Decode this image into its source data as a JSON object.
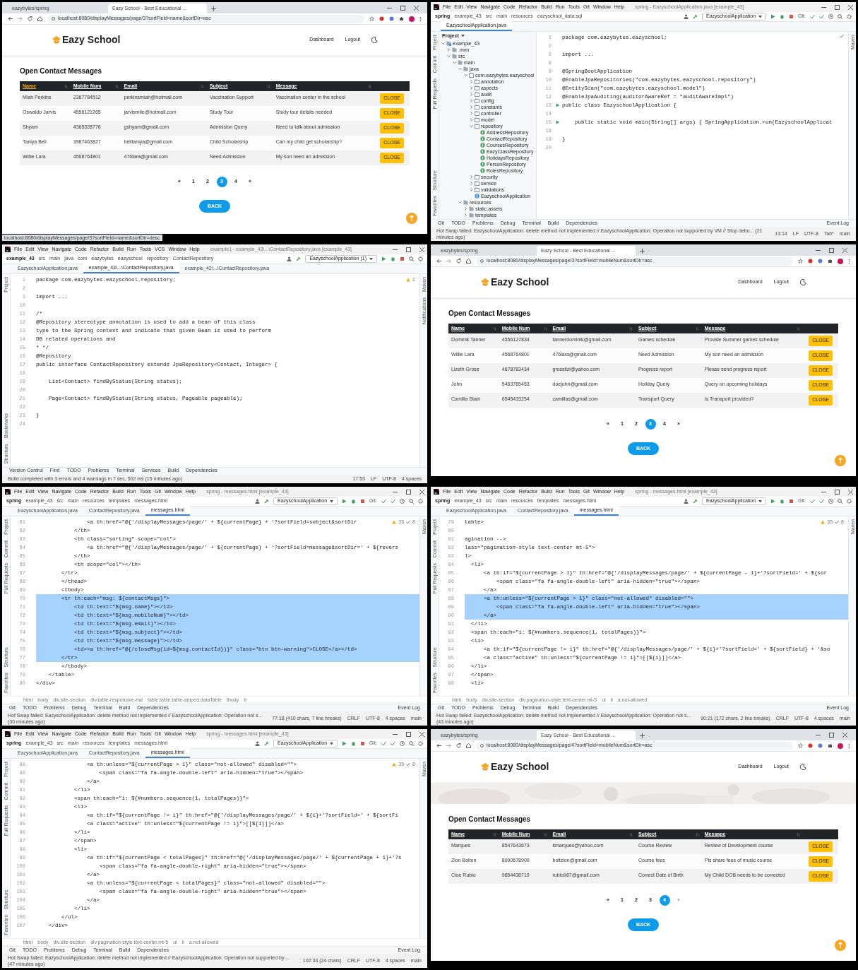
{
  "panels": [
    {
      "kind": "browser",
      "tabs": [
        {
          "title": "eazybytes/spring",
          "selected": false
        },
        {
          "title": "Eazy School - Best Educational ...",
          "selected": true
        }
      ],
      "url": "localhost:8080/displayMessages/page/3?sortField=name&sortDir=asc",
      "logo": "Eazy School",
      "nav": [
        "Dashboard",
        "Logout"
      ],
      "heading": "Open Contact Messages",
      "columns": [
        {
          "label": "Name",
          "active": true
        },
        {
          "label": "Mobile Num",
          "active": false
        },
        {
          "label": "Email",
          "active": false
        },
        {
          "label": "Subject",
          "active": false
        },
        {
          "label": "Message",
          "active": false
        }
      ],
      "rows": [
        {
          "cells": [
            "Miah Perkins",
            "2367784512",
            "perkinsmiah@hotmail.com",
            "Vaccination Support",
            "Vaccination center in the school"
          ],
          "action": "CLOSE"
        },
        {
          "cells": [
            "Oswaldo Jarvis",
            "4556121265",
            "jarvismile@hotmail.com",
            "Study Tour",
            "Study tour details needed"
          ],
          "action": "CLOSE"
        },
        {
          "cells": [
            "Shyam",
            "4365328776",
            "gshyam@gmail.com",
            "Admission Query",
            "Need to talk about admission"
          ],
          "action": "CLOSE"
        },
        {
          "cells": [
            "Taniya Bell",
            "3987463827",
            "belltaniya@gmail.com",
            "Child Scholarship",
            "Can my child get scholarship?"
          ],
          "action": "CLOSE"
        },
        {
          "cells": [
            "Willie Lara",
            "4568764801",
            "476lara@gmail.com",
            "Need Admission",
            "My son need an admission"
          ],
          "action": "CLOSE"
        }
      ],
      "pages": [
        {
          "label": "«",
          "selected": false,
          "disabled": false
        },
        {
          "label": "1",
          "selected": false,
          "disabled": false
        },
        {
          "label": "2",
          "selected": false,
          "disabled": false
        },
        {
          "label": "3",
          "selected": true,
          "disabled": false
        },
        {
          "label": "4",
          "selected": false,
          "disabled": false
        },
        {
          "label": "»",
          "selected": false,
          "disabled": false
        }
      ],
      "back": "BACK",
      "status_link": "localhost:8080/displayMessages/page/3?sortField=name&sortDir=desc"
    },
    {
      "kind": "ide",
      "menu": [
        "File",
        "Edit",
        "View",
        "Navigate",
        "Code",
        "Refactor",
        "Build",
        "Run",
        "Tools",
        "Git",
        "Window",
        "Help"
      ],
      "title": "spring - EazyschoolApplication.java [example_43]",
      "crumbs": [
        "spring",
        "example_43",
        "src",
        "main",
        "resources",
        "eazyschool_data.sql"
      ],
      "run_config": "EazyschoolApplication",
      "git_label": "Git:",
      "tabs": [
        {
          "label": "EazyschoolApplication.java",
          "selected": true
        }
      ],
      "side_top": [
        "Project",
        "Commit",
        "Pull Requests"
      ],
      "side_bottom": [
        "Structure",
        "Favorites"
      ],
      "side_right": [
        "Maven"
      ],
      "tree": {
        "title": "Project",
        "items": [
          {
            "label": "example_43",
            "kind": "module",
            "expanded": true,
            "children": [
              {
                "label": ".mvn",
                "kind": "folder",
                "expanded": false
              },
              {
                "label": "src",
                "kind": "folder",
                "expanded": true,
                "children": [
                  {
                    "label": "main",
                    "kind": "folder",
                    "expanded": true,
                    "children": [
                      {
                        "label": "java",
                        "kind": "folder",
                        "expanded": true,
                        "children": [
                          {
                            "label": "com.eazybytes.eazyschool",
                            "kind": "package",
                            "expanded": true,
                            "children": [
                              {
                                "label": "annotation",
                                "kind": "package",
                                "expanded": false
                              },
                              {
                                "label": "aspects",
                                "kind": "package",
                                "expanded": false
                              },
                              {
                                "label": "audit",
                                "kind": "package",
                                "expanded": false
                              },
                              {
                                "label": "config",
                                "kind": "package",
                                "expanded": false
                              },
                              {
                                "label": "constants",
                                "kind": "package",
                                "expanded": false
                              },
                              {
                                "label": "controller",
                                "kind": "package",
                                "expanded": false
                              },
                              {
                                "label": "model",
                                "kind": "package",
                                "expanded": false
                              },
                              {
                                "label": "repository",
                                "kind": "package",
                                "expanded": true,
                                "children": [
                                  {
                                    "label": "AddressRepository",
                                    "kind": "interface"
                                  },
                                  {
                                    "label": "ContactRepository",
                                    "kind": "interface"
                                  },
                                  {
                                    "label": "CoursesRepository",
                                    "kind": "interface"
                                  },
                                  {
                                    "label": "EazyClassRepository",
                                    "kind": "interface"
                                  },
                                  {
                                    "label": "HolidaysRepository",
                                    "kind": "interface"
                                  },
                                  {
                                    "label": "PersonRepository",
                                    "kind": "interface"
                                  },
                                  {
                                    "label": "RolesRepository",
                                    "kind": "interface"
                                  }
                                ]
                              },
                              {
                                "label": "security",
                                "kind": "package",
                                "expanded": false
                              },
                              {
                                "label": "service",
                                "kind": "package",
                                "expanded": false
                              },
                              {
                                "label": "validations",
                                "kind": "package",
                                "expanded": false
                              },
                              {
                                "label": "EazyschoolApplication",
                                "kind": "class"
                              }
                            ]
                          }
                        ]
                      },
                      {
                        "label": "resources",
                        "kind": "folder",
                        "expanded": true,
                        "children": [
                          {
                            "label": "static.assets",
                            "kind": "folder",
                            "expanded": false
                          },
                          {
                            "label": "templates",
                            "kind": "folder",
                            "expanded": false
                          }
                        ]
                      }
                    ]
                  }
                ]
              }
            ]
          }
        ]
      },
      "inspections": [
        {
          "kind": "ok"
        }
      ],
      "lines": [
        {
          "n": "1",
          "code": "package com.eazybytes.eazyschool;",
          "run": false
        },
        {
          "n": "2",
          "run": false
        },
        {
          "n": "3",
          "code": "import ...",
          "run": false
        },
        {
          "n": "8",
          "run": false
        },
        {
          "n": "9",
          "code": "@SpringBootApplication",
          "run": false
        },
        {
          "n": "10",
          "code": "@EnableJpaRepositories(\"com.eazybytes.eazyschool.repository\")",
          "run": false
        },
        {
          "n": "11",
          "code": "@EntityScan(\"com.eazybytes.eazyschool.model\")",
          "run": false
        },
        {
          "n": "12",
          "code": "@EnableJpaAuditing(auditorAwareRef = \"auditAwareImpl\")",
          "run": false
        },
        {
          "n": "13",
          "code": "public class EazyschoolApplication {",
          "run": true
        },
        {
          "n": "14",
          "run": false
        },
        {
          "n": "15",
          "code": "    public static void main(String[] args) { SpringApplication.run(EazyschoolApplicat",
          "run": true
        },
        {
          "n": "18",
          "run": false
        },
        {
          "n": "19",
          "code": "}",
          "run": false
        },
        {
          "n": "20",
          "run": false
        }
      ],
      "tool_windows": [
        "Git",
        "TODO",
        "Problems",
        "Debug",
        "Terminal",
        "Build",
        "Dependencies"
      ],
      "event_log": "Event Log",
      "status": "Hot Swap failed: EazyschoolApplication: delete method not implemented // EazyschoolApplication: Operation not supported by VM // Stop debu... (21 minutes ago)",
      "status_right": [
        "13:14",
        "LF",
        "UTF-8",
        "Tab*",
        "main"
      ]
    },
    {
      "kind": "ide",
      "menu": [
        "File",
        "Edit",
        "View",
        "Navigate",
        "Code",
        "Refactor",
        "Build",
        "Run",
        "Tools",
        "VCS",
        "Window",
        "Help"
      ],
      "title": "example1 - example_43\\...\\ContactRepository.java [example_43]",
      "crumbs": [
        "example_43",
        "src",
        "main",
        "java",
        "com",
        "eazybytes",
        "eazyschool",
        "repository",
        "ContactRepository"
      ],
      "run_config": "EazyschoolApplication (1)",
      "tabs": [
        {
          "label": "EazyschoolApplication.java",
          "selected": false
        },
        {
          "label": "example_43\\...\\ContactRepository.java",
          "selected": true
        },
        {
          "label": "example_42\\...\\ContactRepository.java",
          "selected": false
        }
      ],
      "side_top": [
        "Project"
      ],
      "side_bottom": [
        "Bookmarks",
        "Structure"
      ],
      "side_right": [
        "Maven",
        "Notifications"
      ],
      "inspections": [
        {
          "kind": "warning",
          "count": "1"
        }
      ],
      "lines": [
        {
          "n": "1",
          "code": "package com.eazybytes.eazyschool.repository;"
        },
        {
          "n": "2"
        },
        {
          "n": "3",
          "code": "import ..."
        },
        {
          "n": "10"
        },
        {
          "n": "11",
          "code": "/*"
        },
        {
          "n": "12",
          "code": "@Repository stereotype annotation is used to add a bean of this class"
        },
        {
          "n": "13",
          "code": "type to the Spring context and indicate that given Bean is used to perform"
        },
        {
          "n": "14",
          "code": "DB related operations and"
        },
        {
          "n": "15",
          "code": "* */"
        },
        {
          "n": "16",
          "code": "@Repository"
        },
        {
          "n": "17",
          "code": "public interface ContactRepository extends JpaRepository<Contact, Integer> {"
        },
        {
          "n": "18"
        },
        {
          "n": "19",
          "code": "    List<Contact> findByStatus(String status);"
        },
        {
          "n": "20"
        },
        {
          "n": "21",
          "code": "    Page<Contact> findByStatus(String status, Pageable pageable);"
        },
        {
          "n": "22"
        },
        {
          "n": "23",
          "code": "}"
        },
        {
          "n": "24"
        }
      ],
      "tool_windows": [
        "Version Control",
        "Find",
        "TODO",
        "Problems",
        "Terminal",
        "Services",
        "Build",
        "Dependencies"
      ],
      "status": "Build completed with 3 errors and 4 warnings in 7 sec, 502 ms (15 minutes ago)",
      "status_right": [
        "17:53",
        "LF",
        "UTF-8",
        "4 spaces"
      ]
    },
    {
      "kind": "browser",
      "tabs": [
        {
          "title": "eazybytes/spring",
          "selected": false
        },
        {
          "title": "Eazy School - Best Educational ...",
          "selected": true
        }
      ],
      "url": "localhost:8080/displayMessages/page/3?sortField=mobileNum&sortDir=asc",
      "logo": "Eazy School",
      "nav": [
        "Dashboard",
        "Logout"
      ],
      "heading": "Open Contact Messages",
      "columns": [
        {
          "label": "Name",
          "active": false
        },
        {
          "label": "Mobile Num",
          "active": false
        },
        {
          "label": "Email",
          "active": false
        },
        {
          "label": "Subject",
          "active": false
        },
        {
          "label": "Message",
          "active": false
        }
      ],
      "rows": [
        {
          "cells": [
            "Dominik Tanner",
            "4556127834",
            "tannerdominik@gmail.com",
            "Games schedule",
            "Provide Summer games schedule"
          ],
          "action": "CLOSE"
        },
        {
          "cells": [
            "Willie Lara",
            "4568764801",
            "476lara@gmail.com",
            "Need Admission",
            "My son need an admission"
          ],
          "action": "CLOSE"
        },
        {
          "cells": [
            "Lizeth Gross",
            "4678783434",
            "grosslizi@yahoo.com",
            "Progress report",
            "Please send progress report"
          ],
          "action": "CLOSE"
        },
        {
          "cells": [
            "John",
            "5463765453",
            "doejohn@gmail.com",
            "Holiday Query",
            "Query on upcoming holidays"
          ],
          "action": "CLOSE"
        },
        {
          "cells": [
            "Camilla Stain",
            "6545433254",
            "camillas@gmail.com",
            "Transport Query",
            "Is Transport provided?"
          ],
          "action": "CLOSE"
        }
      ],
      "pages": [
        {
          "label": "«",
          "selected": false,
          "disabled": false
        },
        {
          "label": "1",
          "selected": false,
          "disabled": false
        },
        {
          "label": "2",
          "selected": false,
          "disabled": false
        },
        {
          "label": "3",
          "selected": true,
          "disabled": false
        },
        {
          "label": "4",
          "selected": false,
          "disabled": false
        },
        {
          "label": "»",
          "selected": false,
          "disabled": false
        }
      ],
      "back": "BACK"
    },
    {
      "kind": "ide",
      "menu": [
        "File",
        "Edit",
        "View",
        "Navigate",
        "Code",
        "Refactor",
        "Build",
        "Run",
        "Tools",
        "Git",
        "Window",
        "Help"
      ],
      "title": "spring - messages.html [example_43]",
      "crumbs": [
        "spring",
        "example_43",
        "src",
        "main",
        "resources",
        "templates",
        "messages.html"
      ],
      "run_config": "EazyschoolApplication",
      "git_label": "Git:",
      "tabs": [
        {
          "label": "EazyschoolApplication.java",
          "selected": false
        },
        {
          "label": "ContactRepository.java",
          "selected": false
        },
        {
          "label": "messages.html",
          "selected": true
        }
      ],
      "side_top": [
        "Project",
        "Commit",
        "Pull Requests"
      ],
      "side_bottom": [
        "Structure",
        "Favorites"
      ],
      "side_right": [
        "Maven"
      ],
      "inspections": [
        {
          "kind": "warning",
          "count": "35"
        },
        {
          "kind": "check",
          "count": "8"
        }
      ],
      "lines": [
        {
          "n": "61",
          "code": "                <a th:href=\"@{'/displayMessages/page/' + ${currentPage} + '?sortField=subject&sortDir",
          "selected": false
        },
        {
          "n": "62",
          "code": "            </th>",
          "selected": false
        },
        {
          "n": "63",
          "code": "            <th class=\"sorting\" scope=\"col\">",
          "selected": false
        },
        {
          "n": "64",
          "code": "                <a th:href=\"@{'/displayMessages/page/' + ${currentPage} + '?sortField=message&sortDir=' + ${revers",
          "selected": false
        },
        {
          "n": "65",
          "code": "            </th>",
          "selected": false
        },
        {
          "n": "66",
          "code": "            <th scope=\"col\"></th>",
          "selected": false
        },
        {
          "n": "67",
          "code": "        </tr>",
          "selected": false
        },
        {
          "n": "68",
          "code": "        </thead>",
          "selected": false
        },
        {
          "n": "69",
          "code": "        <tbody>",
          "selected": false
        },
        {
          "n": "70",
          "code": "        <tr th:each=\"msg: ${contactMsgs}\">",
          "selected": true
        },
        {
          "n": "71",
          "code": "            <td th:text=\"${msg.name}\"></td>",
          "selected": true
        },
        {
          "n": "72",
          "code": "            <td th:text=\"${msg.mobileNum}\"></td>",
          "selected": true
        },
        {
          "n": "73",
          "code": "            <td th:text=\"${msg.email}\"></td>",
          "selected": true
        },
        {
          "n": "74",
          "code": "            <td th:text=\"${msg.subject}\"></td>",
          "selected": true
        },
        {
          "n": "75",
          "code": "            <td th:text=\"${msg.message}\"></td>",
          "selected": true
        },
        {
          "n": "76",
          "code": "            <td><a th:href=\"@{/closeMsg(id=${msg.contactId})}\" class=\"btn btn-warning\">CLOSE</a></td>",
          "selected": true
        },
        {
          "n": "77",
          "code": "        </tr>",
          "selected": true
        },
        {
          "n": "78",
          "code": "        </tbody>",
          "selected": false
        },
        {
          "n": "79",
          "code": "    </table>",
          "selected": false
        },
        {
          "n": "80",
          "code": "</div>",
          "selected": false
        }
      ],
      "path": [
        "html",
        "body",
        "div.site-section",
        "div.table-responsive-md",
        "table.table.table-striped.dataTable",
        "tbody",
        "tr"
      ],
      "tool_windows": [
        "Git",
        "TODO",
        "Problems",
        "Debug",
        "Terminal",
        "Build",
        "Dependencies"
      ],
      "event_log": "Event Log",
      "status": "Hot Swap failed: EazyschoolApplication: delete method not implemented // EazyschoolApplication: Operation not s... (30 minutes ago)",
      "status_right": [
        "77:18 (410 chars, 7 line breaks)",
        "CRLF",
        "UTF-8",
        "4 spaces",
        "main"
      ]
    },
    {
      "kind": "ide",
      "menu": [
        "File",
        "Edit",
        "View",
        "Navigate",
        "Code",
        "Refactor",
        "Build",
        "Run",
        "Tools",
        "Git",
        "Window",
        "Help"
      ],
      "title": "spring - messages.html [example_43]",
      "crumbs": [
        "spring",
        "example_43",
        "src",
        "main",
        "resources",
        "templates",
        "messages.html"
      ],
      "run_config": "EazyschoolApplication",
      "git_label": "Git:",
      "tabs": [
        {
          "label": "EazyschoolApplication.java",
          "selected": false
        },
        {
          "label": "ContactRepository.java",
          "selected": false
        },
        {
          "label": "messages.html",
          "selected": true
        }
      ],
      "side_top": [
        "Project",
        "Commit",
        "Pull Requests"
      ],
      "side_bottom": [
        "Structure",
        "Favorites"
      ],
      "side_right": [
        "Maven"
      ],
      "inspections": [
        {
          "kind": "warning",
          "count": "35"
        },
        {
          "kind": "check",
          "count": "8"
        }
      ],
      "lines": [
        {
          "n": "79",
          "code": "table>",
          "selected": false
        },
        {
          "n": "80",
          "selected": false
        },
        {
          "n": "81",
          "code": "agination -->",
          "selected": false
        },
        {
          "n": "82",
          "code": "lass=\"pagination-style text-center mt-5\">",
          "selected": false
        },
        {
          "n": "83",
          "code": "l>",
          "selected": false
        },
        {
          "n": "84",
          "code": "  <li>",
          "selected": false
        },
        {
          "n": "85",
          "code": "      <a th:if=\"${currentPage > 1}\" th:href=\"@{'/displayMessages/page/' + ${currentPage - 1}+'?sortField=' + ${sor",
          "selected": false
        },
        {
          "n": "86",
          "code": "          <span class=\"fa fa-angle-double-left\" aria-hidden=\"true\"></span>",
          "selected": false
        },
        {
          "n": "87",
          "code": "      </a>",
          "selected": false
        },
        {
          "n": "88",
          "code": "      <a th:unless=\"${currentPage > 1}\" class=\"not-allowed\" disabled=\"\">",
          "selected": true
        },
        {
          "n": "89",
          "code": "          <span class=\"fa fa-angle-double-left\" aria-hidden=\"true\"></span>",
          "selected": true
        },
        {
          "n": "90",
          "code": "      </a>",
          "selected": true
        },
        {
          "n": "91",
          "code": "  </li>",
          "selected": false
        },
        {
          "n": "92",
          "code": "  <span th:each=\"i: ${#numbers.sequence(1, totalPages)}\">",
          "selected": false
        },
        {
          "n": "93",
          "code": "  <li>",
          "selected": false
        },
        {
          "n": "94",
          "code": "      <a th:if=\"${currentPage != i}\" th:href=\"@{'/displayMessages/page/' + ${i}+'?sortField=' + ${sortField} + '&so",
          "selected": false
        },
        {
          "n": "95",
          "code": "      <a class=\"active\" th:unless=\"${currentPage != i}\">[[${i}]]</a>",
          "selected": false
        },
        {
          "n": "96",
          "code": "  </li>",
          "selected": false
        },
        {
          "n": "97",
          "code": "  </span>",
          "selected": false
        },
        {
          "n": "98",
          "code": "  <li>",
          "selected": false
        }
      ],
      "path": [
        "html",
        "body",
        "div.site-section",
        "div.pagination-style.text-center.mt-5",
        "ul",
        "li",
        "a.not-allowed"
      ],
      "tool_windows": [
        "Git",
        "TODO",
        "Problems",
        "Debug",
        "Terminal",
        "Build",
        "Dependencies"
      ],
      "event_log": "Event Log",
      "status": "Hot Swap failed: EazyschoolApplication: delete method not implemented // EazyschoolApplication: Operation not s... (43 minutes ago)",
      "status_right": [
        "90:21 (172 chars, 2 line breaks)",
        "CRLF",
        "UTF-8",
        "4 spaces",
        "main"
      ]
    },
    {
      "kind": "ide",
      "menu": [
        "File",
        "Edit",
        "View",
        "Navigate",
        "Code",
        "Refactor",
        "Build",
        "Run",
        "Tools",
        "Git",
        "Window",
        "Help"
      ],
      "title": "spring - messages.html [example_43]",
      "crumbs": [
        "spring",
        "example_43",
        "src",
        "main",
        "resources",
        "templates",
        "messages.html"
      ],
      "run_config": "EazyschoolApplication",
      "git_label": "Git:",
      "tabs": [
        {
          "label": "EazyschoolApplication.java",
          "selected": false
        },
        {
          "label": "ContactRepository.java",
          "selected": false
        },
        {
          "label": "messages.html",
          "selected": true
        }
      ],
      "side_top": [
        "Project",
        "Commit",
        "Pull Requests"
      ],
      "side_bottom": [
        "Structure",
        "Favorites"
      ],
      "side_right": [
        "Maven"
      ],
      "inspections": [
        {
          "kind": "warning",
          "count": "35"
        },
        {
          "kind": "check",
          "count": "8"
        }
      ],
      "lines": [
        {
          "n": "88",
          "code": "                <a th:unless=\"${currentPage > 1}\" class=\"not-allowed\" disabled=\"\">"
        },
        {
          "n": "89",
          "code": "                    <span class=\"fa fa-angle-double-left\" aria-hidden=\"true\"></span>"
        },
        {
          "n": "90",
          "code": "                </a>"
        },
        {
          "n": "91",
          "code": "            </li>"
        },
        {
          "n": "92",
          "code": "            <span th:each=\"i: ${#numbers.sequence(1, totalPages)}\">"
        },
        {
          "n": "93",
          "code": "            <li>"
        },
        {
          "n": "94",
          "code": "                <a th:if=\"${currentPage != i}\" th:href=\"@{'/displayMessages/page/' + ${i}+'?sortField=' + ${sortFi"
        },
        {
          "n": "95",
          "code": "                <a class=\"active\" th:unless=\"${currentPage != i}\">[[${i}]]</a>"
        },
        {
          "n": "96",
          "code": "            </li>"
        },
        {
          "n": "97",
          "code": "            </span>"
        },
        {
          "n": "98",
          "code": "            <li>"
        },
        {
          "n": "99",
          "code": "                <a th:if=\"${currentPage < totalPages}\" th:href=\"@{'/displayMessages/page/' + ${currentPage + 1}+'?s"
        },
        {
          "n": "100",
          "code": "                    <span class=\"fa fa-angle-double-right\" aria-hidden=\"true\"></span>"
        },
        {
          "n": "101",
          "code": "                </a>"
        },
        {
          "n": "102",
          "code": "                <a th:unless=\"${currentPage < totalPages}\" class=\"not-allowed\" disabled=\"\">"
        },
        {
          "n": "103",
          "code": "                    <span class=\"fa fa-angle-double-right\" aria-hidden=\"true\"></span>"
        },
        {
          "n": "104",
          "code": "                </a>"
        },
        {
          "n": "105",
          "code": "            </li>"
        },
        {
          "n": "106",
          "code": "        </ul>"
        },
        {
          "n": "107",
          "code": "    </div>"
        }
      ],
      "path": [
        "html",
        "body",
        "div.site-section",
        "div.pagination-style.text-center.mt-5",
        "ul",
        "li",
        "a.not-allowed"
      ],
      "tool_windows": [
        "Git",
        "TODO",
        "Problems",
        "Debug",
        "Terminal",
        "Build",
        "Dependencies"
      ],
      "event_log": "Event Log",
      "status": "Hot Swap failed: EazyschoolApplication: delete method not implemented // EazyschoolApplication: Operation not supported by ... (47 minutes ago)",
      "status_right": [
        "102:33 (24 chars)",
        "CRLF",
        "UTF-8",
        "4 spaces",
        "main"
      ]
    },
    {
      "kind": "browser",
      "tabs": [
        {
          "title": "eazybytes/spring",
          "selected": false
        },
        {
          "title": "Eazy School - Best Educational ...",
          "selected": true
        }
      ],
      "url": "localhost:8080/displayMessages/page/4?sortField=mobileNum&sortDir=asc",
      "logo": "Eazy School",
      "nav": [
        "Dashboard",
        "Logout"
      ],
      "hero": {
        "kind": "picture"
      },
      "heading": "Open Contact Messages",
      "columns": [
        {
          "label": "Name",
          "active": false
        },
        {
          "label": "Mobile Num",
          "active": false
        },
        {
          "label": "Email",
          "active": false
        },
        {
          "label": "Subject",
          "active": false
        },
        {
          "label": "Message",
          "active": false
        }
      ],
      "rows": [
        {
          "cells": [
            "Marques",
            "8547643673",
            "kmarques@yahoo.com",
            "Course Review",
            "Review of Development course"
          ],
          "action": "CLOSE"
        },
        {
          "cells": [
            "Zion Bolton",
            "8990678900",
            "boltzion@gmail.com",
            "Course fees",
            "Pls share fees of music course"
          ],
          "action": "CLOSE"
        },
        {
          "cells": [
            "Cloe Rubio",
            "9854438719",
            "rubio987@gmail.com",
            "Correct Date of Birth",
            "My Child DOB needs to be corrected"
          ],
          "action": "CLOSE"
        }
      ],
      "pages": [
        {
          "label": "«",
          "selected": false,
          "disabled": false
        },
        {
          "label": "1",
          "selected": false,
          "disabled": false
        },
        {
          "label": "2",
          "selected": false,
          "disabled": false
        },
        {
          "label": "3",
          "selected": false,
          "disabled": false
        },
        {
          "label": "4",
          "selected": true,
          "disabled": false
        },
        {
          "label": "»",
          "selected": false,
          "disabled": true
        }
      ],
      "back": "BACK"
    }
  ]
}
